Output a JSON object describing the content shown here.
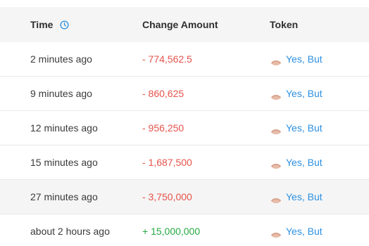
{
  "table": {
    "headers": {
      "time": "Time",
      "change_amount": "Change Amount",
      "token": "Token"
    },
    "header_icon": "clock-icon",
    "rows": [
      {
        "time": "2 minutes ago",
        "amount": "- 774,562.5",
        "direction": "negative",
        "token": "Yes, But"
      },
      {
        "time": "9 minutes ago",
        "amount": "- 860,625",
        "direction": "negative",
        "token": "Yes, But"
      },
      {
        "time": "12 minutes ago",
        "amount": "- 956,250",
        "direction": "negative",
        "token": "Yes, But"
      },
      {
        "time": "15 minutes ago",
        "amount": "- 1,687,500",
        "direction": "negative",
        "token": "Yes, But"
      },
      {
        "time": "27 minutes ago",
        "amount": "- 3,750,000",
        "direction": "negative",
        "token": "Yes, But"
      },
      {
        "time": "about 2 hours ago",
        "amount": "+ 15,000,000",
        "direction": "positive",
        "token": "Yes, But"
      }
    ],
    "token_icon": "token-avatar-icon"
  },
  "colors": {
    "negative": "#e5534b",
    "positive": "#27a843",
    "link": "#2b8fe0",
    "header_bg": "#f5f5f5"
  }
}
